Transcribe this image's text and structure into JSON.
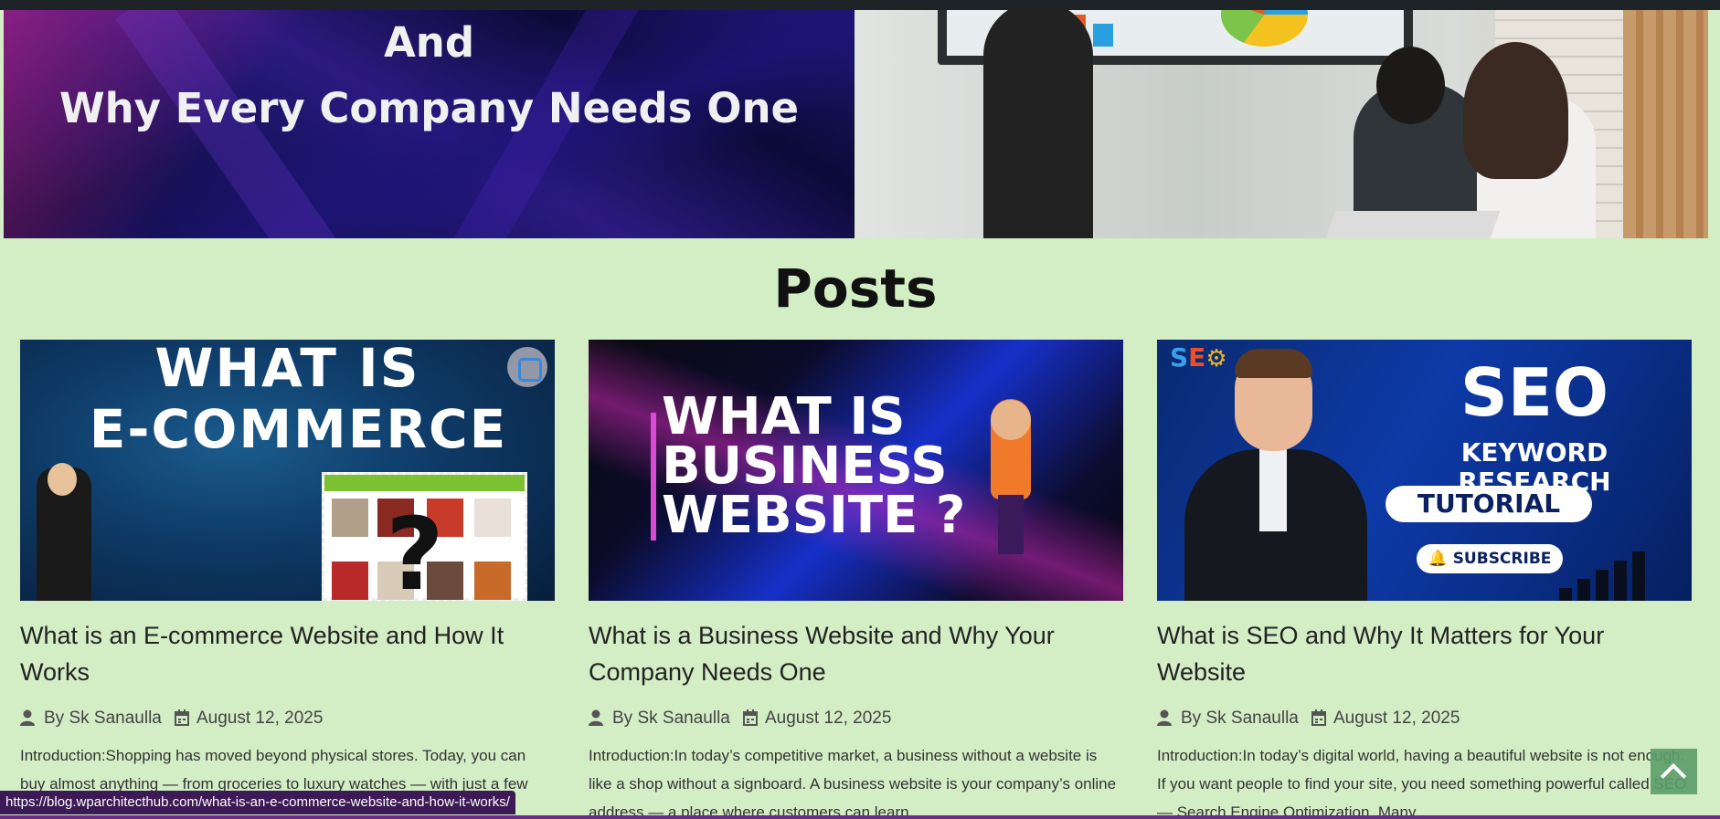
{
  "hero": {
    "title_line1": "And",
    "title_line2": "Why Every Company Needs One"
  },
  "posts_heading": "Posts",
  "posts": [
    {
      "thumb": {
        "line1": "WHAT IS",
        "line2": "E-COMMERCE",
        "mark": "?"
      },
      "title": "What is an E-commerce Website and How It Works",
      "author": "By Sk Sanaulla",
      "date": "August 12, 2025",
      "excerpt": "Introduction:Shopping has moved beyond physical stores. Today, you can buy almost anything — from groceries to luxury watches — with just a few"
    },
    {
      "thumb": {
        "line1": "WHAT IS",
        "line2": "BUSINESS",
        "line3": "WEBSITE ?"
      },
      "title": "What is a Business Website and Why Your Company Needs One",
      "author": "By Sk Sanaulla",
      "date": "August 12, 2025",
      "excerpt": "Introduction:In today’s competitive market, a business without a website is like a shop without a signboard. A business website is your company’s online address — a place where customers can learn"
    },
    {
      "thumb": {
        "logo_s": "S",
        "logo_e": "E",
        "seo": "SEO",
        "subtitle": "KEYWORD RESEARCH",
        "tutorial": "TUTORIAL",
        "subscribe": "SUBSCRIBE"
      },
      "title": "What is SEO and Why It Matters for Your Website",
      "author": "By Sk Sanaulla",
      "date": "August 12, 2025",
      "excerpt": "Introduction:In today’s digital world, having a beautiful website is not enough. If you want people to find your site, you need something powerful called SEO — Search Engine Optimization. Many"
    }
  ],
  "status_url": "https://blog.wparchitecthub.com/what-is-an-e-commerce-website-and-how-it-works/",
  "icons": [
    "user-icon",
    "calendar-icon",
    "scan-icon",
    "bell-icon",
    "chevron-up-icon"
  ],
  "colors": {
    "page_bg": "#d3edc5",
    "status_bg": "#3c1a55",
    "scroll_btn": "#5c9e6a"
  }
}
